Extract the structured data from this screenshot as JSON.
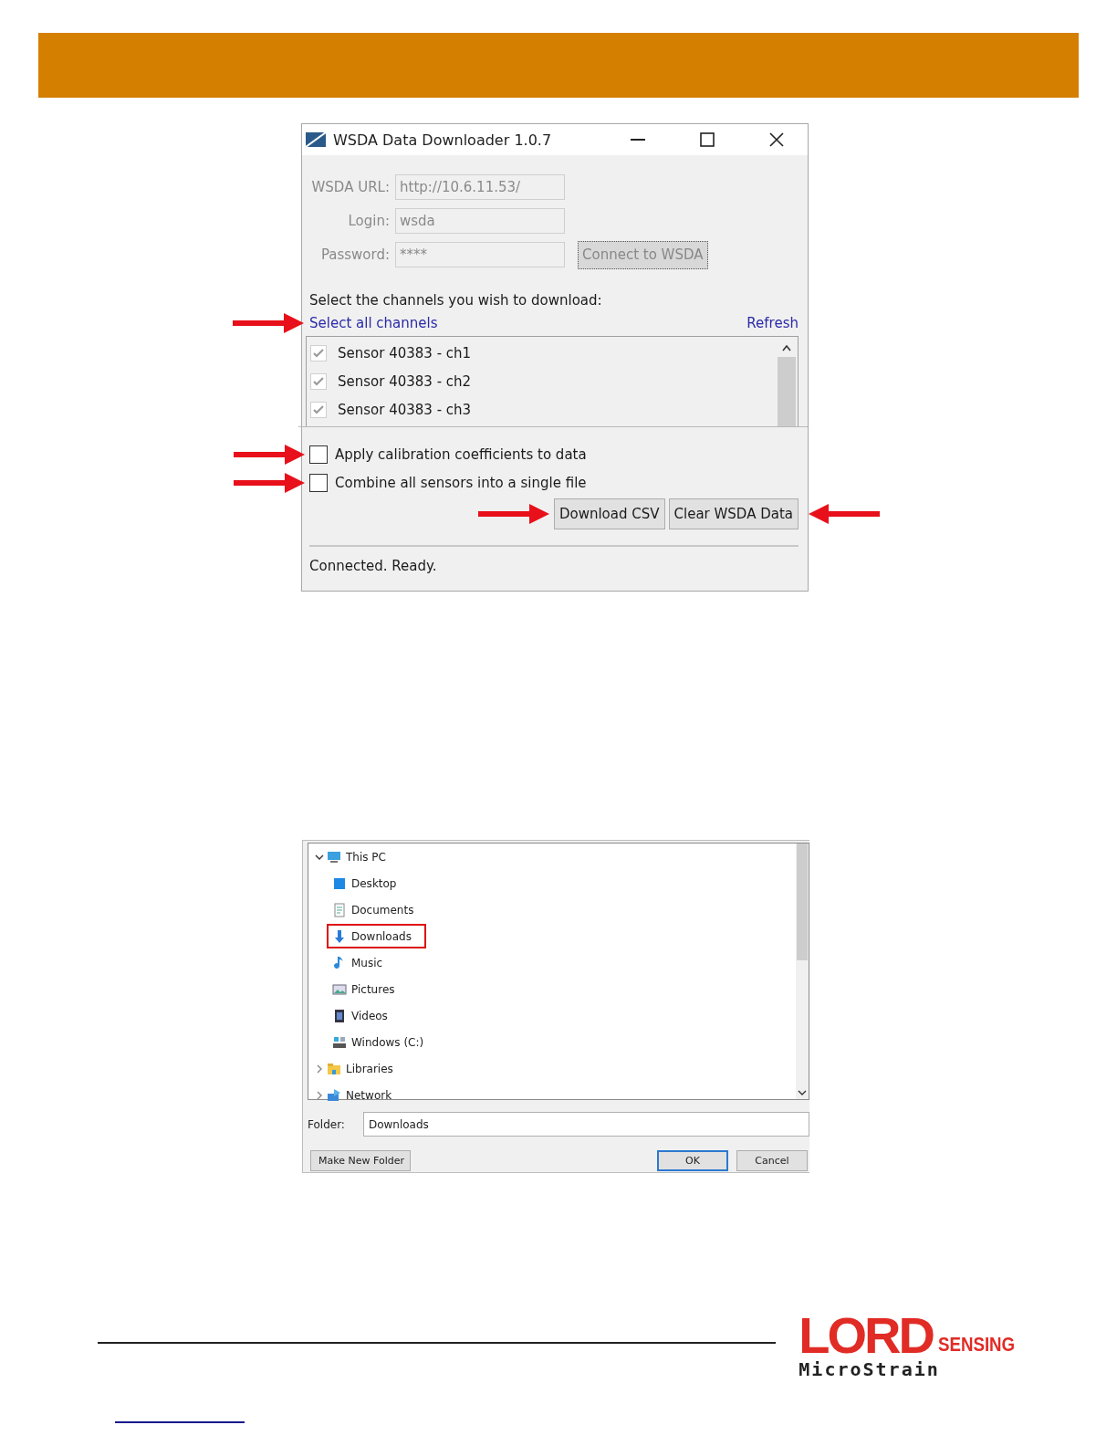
{
  "downloader": {
    "title": "WSDA Data Downloader 1.0.7",
    "fields": [
      {
        "label": "WSDA URL:",
        "value": "http://10.6.11.53/",
        "disabled": true
      },
      {
        "label": "Login:",
        "value": "wsda",
        "disabled": true
      },
      {
        "label": "Password:",
        "value": "****",
        "disabled": true
      }
    ],
    "connect_button": {
      "label": "Connect to WSDA",
      "disabled": true
    },
    "prompt": "Select the channels you wish to download:",
    "select_all": {
      "label": "Select all channels",
      "arrow_before": true
    },
    "refresh": {
      "label": "Refresh"
    },
    "channels": [
      {
        "label": "Sensor 40383 - ch1",
        "checked": true,
        "disabled": true
      },
      {
        "label": "Sensor 40383 - ch2",
        "checked": true,
        "disabled": true
      },
      {
        "label": "Sensor 40383 - ch3",
        "checked": true,
        "disabled": true
      }
    ],
    "options": [
      {
        "label": "Apply calibration coefficients to data",
        "checked": false,
        "arrow_before": true
      },
      {
        "label": "Combine all sensors into a single file",
        "checked": false,
        "arrow_before": true
      }
    ],
    "buttons": [
      {
        "label": "Download CSV",
        "arrow_before": true
      },
      {
        "label": "Clear WSDA Data",
        "arrow_after": true
      }
    ],
    "status": "Connected. Ready."
  },
  "folder_dialog": {
    "tree": [
      {
        "label": "This PC",
        "kind": "computer",
        "expanded": true,
        "selected": false,
        "children": [
          {
            "label": "Desktop",
            "kind": "desktop",
            "selected": false
          },
          {
            "label": "Documents",
            "kind": "documents",
            "selected": false
          },
          {
            "label": "Downloads",
            "kind": "downloads",
            "selected": true
          },
          {
            "label": "Music",
            "kind": "music",
            "selected": false
          },
          {
            "label": "Pictures",
            "kind": "pictures",
            "selected": false
          },
          {
            "label": "Videos",
            "kind": "videos",
            "selected": false
          },
          {
            "label": "Windows (C:)",
            "kind": "drive",
            "selected": false
          }
        ]
      },
      {
        "label": "Libraries",
        "kind": "libraries",
        "expanded": false,
        "selected": false
      },
      {
        "label": "Network",
        "kind": "network",
        "expanded": false,
        "selected": false
      }
    ],
    "folder_label": "Folder:",
    "folder_value": "Downloads",
    "buttons": [
      {
        "label": "Make New Folder",
        "default": false
      },
      {
        "label": "OK",
        "default": true
      },
      {
        "label": "Cancel",
        "default": false
      }
    ]
  },
  "logo": {
    "name": "LORD",
    "tagline": "SENSING",
    "sub": "MicroStrain"
  }
}
